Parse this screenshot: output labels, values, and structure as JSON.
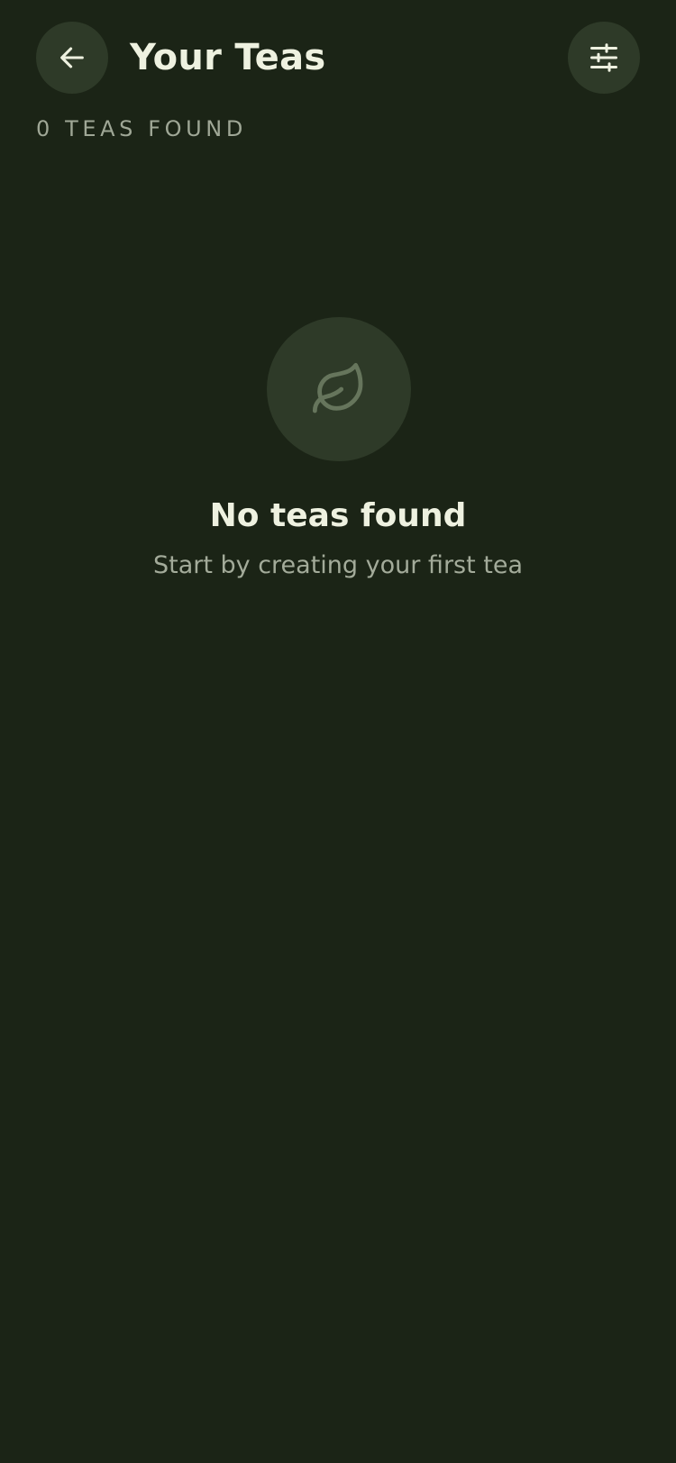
{
  "header": {
    "title": "Your Teas",
    "back_icon": "arrow-left-icon",
    "filter_icon": "sliders-icon"
  },
  "summary": {
    "count_label": "0 TEAS FOUND"
  },
  "empty_state": {
    "icon": "leaf-icon",
    "title": "No teas found",
    "subtitle": "Start by creating your first tea"
  },
  "colors": {
    "background": "#1b2416",
    "surface": "#2e3a28",
    "text_primary": "#eef1e0",
    "text_secondary": "#a3ab9a",
    "icon_muted": "#66755c"
  }
}
